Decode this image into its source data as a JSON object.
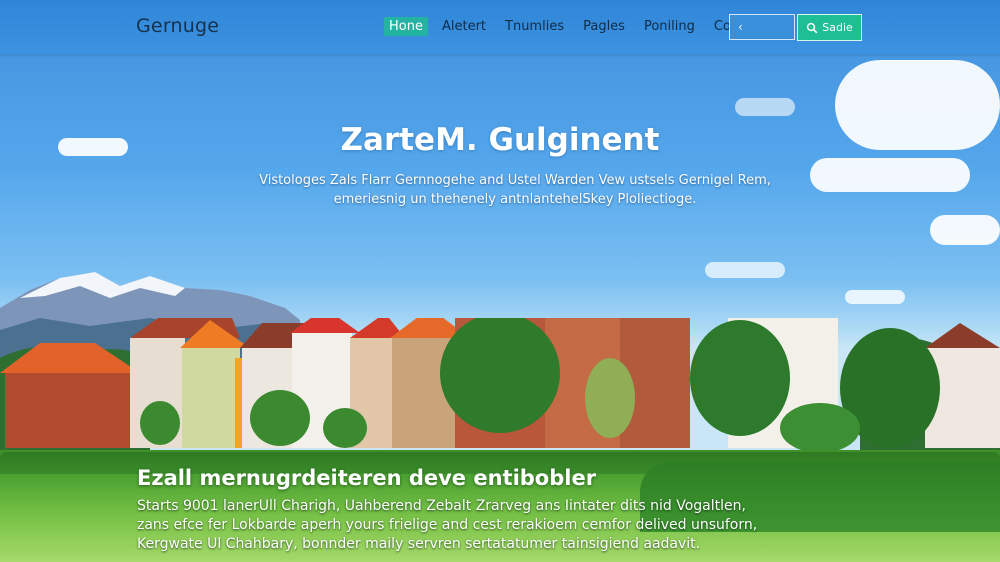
{
  "brand": {
    "name": "Gernuge"
  },
  "nav": {
    "items": [
      {
        "label": "Hone",
        "active": true
      },
      {
        "label": "Aletert",
        "active": false
      },
      {
        "label": "Tnumlies",
        "active": false
      },
      {
        "label": "Pagles",
        "active": false
      },
      {
        "label": "Poniling",
        "active": false
      },
      {
        "label": "Colotanst",
        "active": false
      }
    ]
  },
  "search": {
    "value": "‹",
    "button_label": "Sadie",
    "icon": "search-icon"
  },
  "hero": {
    "title": "ZarteM. Gulginent",
    "subtitle_lines": [
      "Vistologes Zals Flarr Gernnogehe and Ustel Warden Vew ustsels Gernigel Rem,",
      "emeriesnig un thehenely antnlantehelSkey Ploliectioge."
    ]
  },
  "section": {
    "title": "Ezall mernugrdeiteren deve entibobler",
    "body_lines": [
      "Starts 9001 lanerUll Charigh, Uahberend Zebalt Zrarveg ans Iintater dits nid Vogaltlen,",
      "zans efce fer Lokbarde aperh yours frielige and cest rerakioem cemfor delived unsuforn,",
      "Kergwate Ul Chahbary, bonnder  maily servren sertatatumer tainsigiend aadavit."
    ]
  },
  "colors": {
    "navbar": "#3d93e0",
    "active_tab": "#23b3a0",
    "search_button": "#1fbf96",
    "brand_text": "#16324f"
  }
}
